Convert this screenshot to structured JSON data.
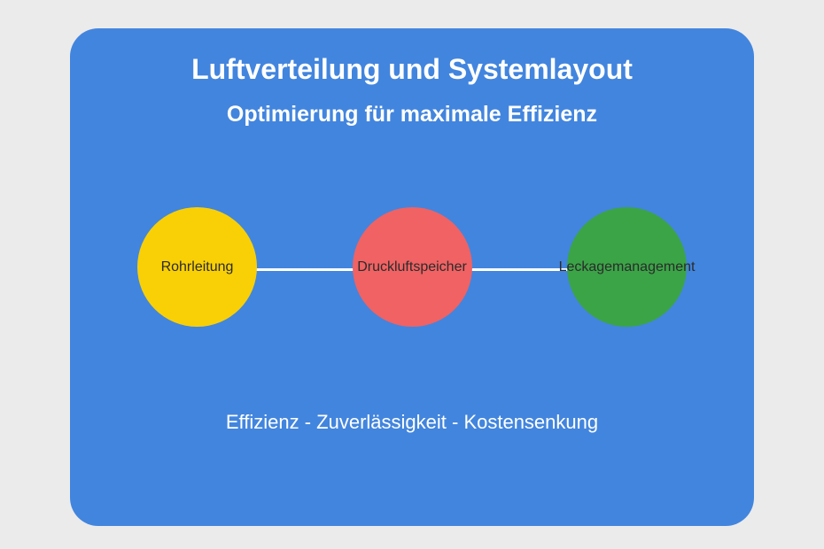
{
  "card": {
    "title": "Luftverteilung und Systemlayout",
    "subtitle": "Optimierung für maximale Effizienz",
    "footer": "Effizienz - Zuverlässigkeit - Kostensenkung"
  },
  "circles": [
    {
      "label": "Rohrleitung",
      "color": "yellow"
    },
    {
      "label": "Druckluftspeicher",
      "color": "red"
    },
    {
      "label": "Leckagemanagement",
      "color": "green"
    }
  ]
}
